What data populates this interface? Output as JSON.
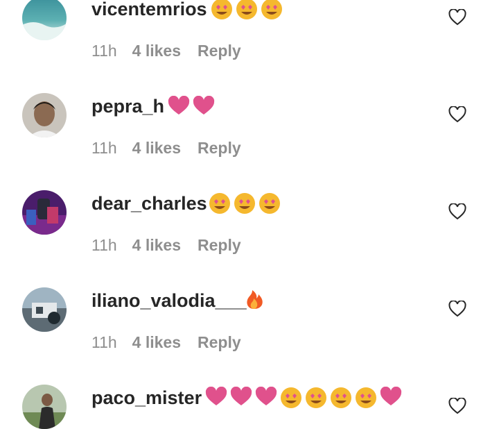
{
  "comments": [
    {
      "username": "vicentemrios",
      "emojis": [
        "heart-eyes",
        "heart-eyes",
        "heart-eyes"
      ],
      "time": "11h",
      "likes": "4 likes",
      "reply": "Reply",
      "avatar": "avatar-ocean-wave",
      "like_icon": "heart-outline-icon"
    },
    {
      "username": "pepra_h",
      "emojis": [
        "pink-heart",
        "pink-heart"
      ],
      "time": "11h",
      "likes": "4 likes",
      "reply": "Reply",
      "avatar": "avatar-person-portrait",
      "like_icon": "heart-outline-icon"
    },
    {
      "username": "dear_charles",
      "emojis": [
        "heart-eyes",
        "heart-eyes",
        "heart-eyes"
      ],
      "time": "11h",
      "likes": "4 likes",
      "reply": "Reply",
      "avatar": "avatar-purple-scene",
      "like_icon": "heart-outline-icon"
    },
    {
      "username": "iliano_valodia___",
      "emojis": [
        "fire"
      ],
      "time": "11h",
      "likes": "4 likes",
      "reply": "Reply",
      "avatar": "avatar-outdoor-scene",
      "like_icon": "heart-outline-icon"
    },
    {
      "username": "paco_mister",
      "emojis": [
        "pink-heart",
        "pink-heart",
        "pink-heart",
        "heart-eyes",
        "heart-eyes",
        "heart-eyes",
        "heart-eyes",
        "pink-heart"
      ],
      "avatar": "avatar-person-field",
      "like_icon": "heart-outline-icon"
    }
  ],
  "colors": {
    "username": "#262626",
    "meta": "#8e8e8e",
    "pink_heart": "#e0518c",
    "emoji_face": "#f5b82e"
  }
}
